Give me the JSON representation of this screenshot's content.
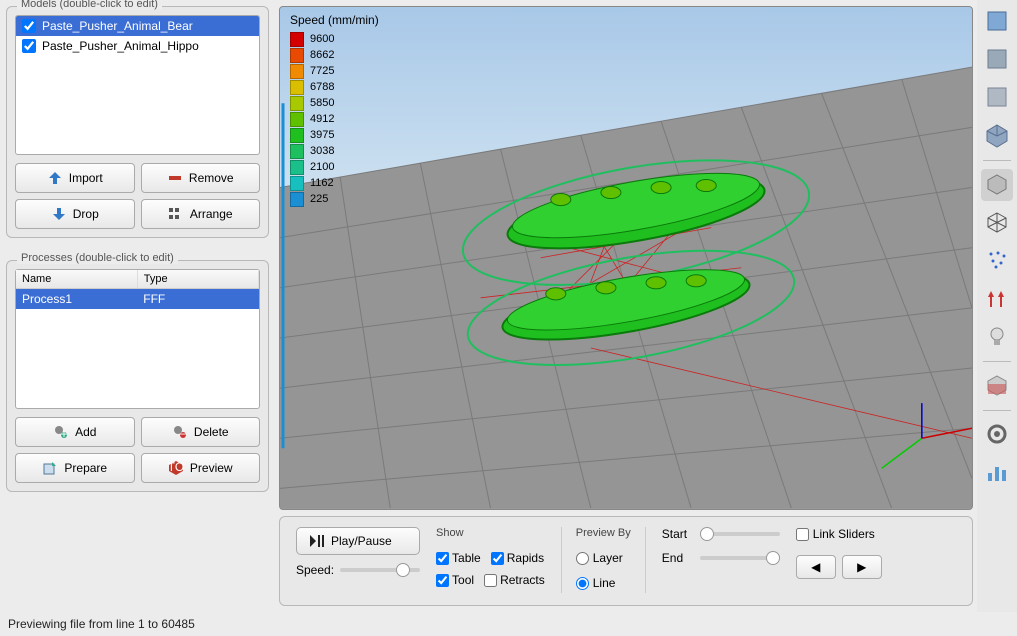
{
  "models": {
    "title": "Models (double-click to edit)",
    "items": [
      {
        "label": "Paste_Pusher_Animal_Bear",
        "checked": true,
        "selected": true
      },
      {
        "label": "Paste_Pusher_Animal_Hippo",
        "checked": true,
        "selected": false
      }
    ],
    "buttons": {
      "import": "Import",
      "remove": "Remove",
      "drop": "Drop",
      "arrange": "Arrange"
    }
  },
  "processes": {
    "title": "Processes (double-click to edit)",
    "cols": {
      "name": "Name",
      "type": "Type"
    },
    "rows": [
      {
        "name": "Process1",
        "type": "FFF",
        "selected": true
      }
    ],
    "buttons": {
      "add": "Add",
      "delete": "Delete",
      "prepare": "Prepare",
      "preview": "Preview"
    }
  },
  "legend": {
    "title": "Speed (mm/min)",
    "entries": [
      {
        "value": "9600",
        "color": "#d40000"
      },
      {
        "value": "8662",
        "color": "#e74a00"
      },
      {
        "value": "7725",
        "color": "#f08a00"
      },
      {
        "value": "6788",
        "color": "#d9bf00"
      },
      {
        "value": "5850",
        "color": "#a8c800"
      },
      {
        "value": "4912",
        "color": "#5fc000"
      },
      {
        "value": "3975",
        "color": "#1fbf1f"
      },
      {
        "value": "3038",
        "color": "#1dbf5f"
      },
      {
        "value": "2100",
        "color": "#1abf8a"
      },
      {
        "value": "1162",
        "color": "#18bfbf"
      },
      {
        "value": "225",
        "color": "#1a8fd4"
      }
    ]
  },
  "playback": {
    "play_label": "Play/Pause",
    "speed_label": "Speed:",
    "show_label": "Show",
    "show": {
      "table": "Table",
      "tool": "Tool",
      "rapids": "Rapids",
      "retracts": "Retracts"
    },
    "show_checked": {
      "table": true,
      "tool": true,
      "rapids": true,
      "retracts": false
    },
    "previewby_label": "Preview By",
    "previewby": {
      "layer": "Layer",
      "line": "Line"
    },
    "previewby_value": "line",
    "start_label": "Start",
    "end_label": "End",
    "link_label": "Link Sliders",
    "link_checked": false
  },
  "status": "Previewing file from line 1 to 60485",
  "toolbar": {
    "items": [
      "view-top-icon",
      "view-front-icon",
      "view-side-icon",
      "view-iso-icon",
      "divider",
      "solid-view-icon",
      "wireframe-icon",
      "points-icon",
      "normals-icon",
      "light-icon",
      "divider",
      "section-icon",
      "divider",
      "settings-icon",
      "stats-icon"
    ],
    "active": "solid-view-icon"
  }
}
